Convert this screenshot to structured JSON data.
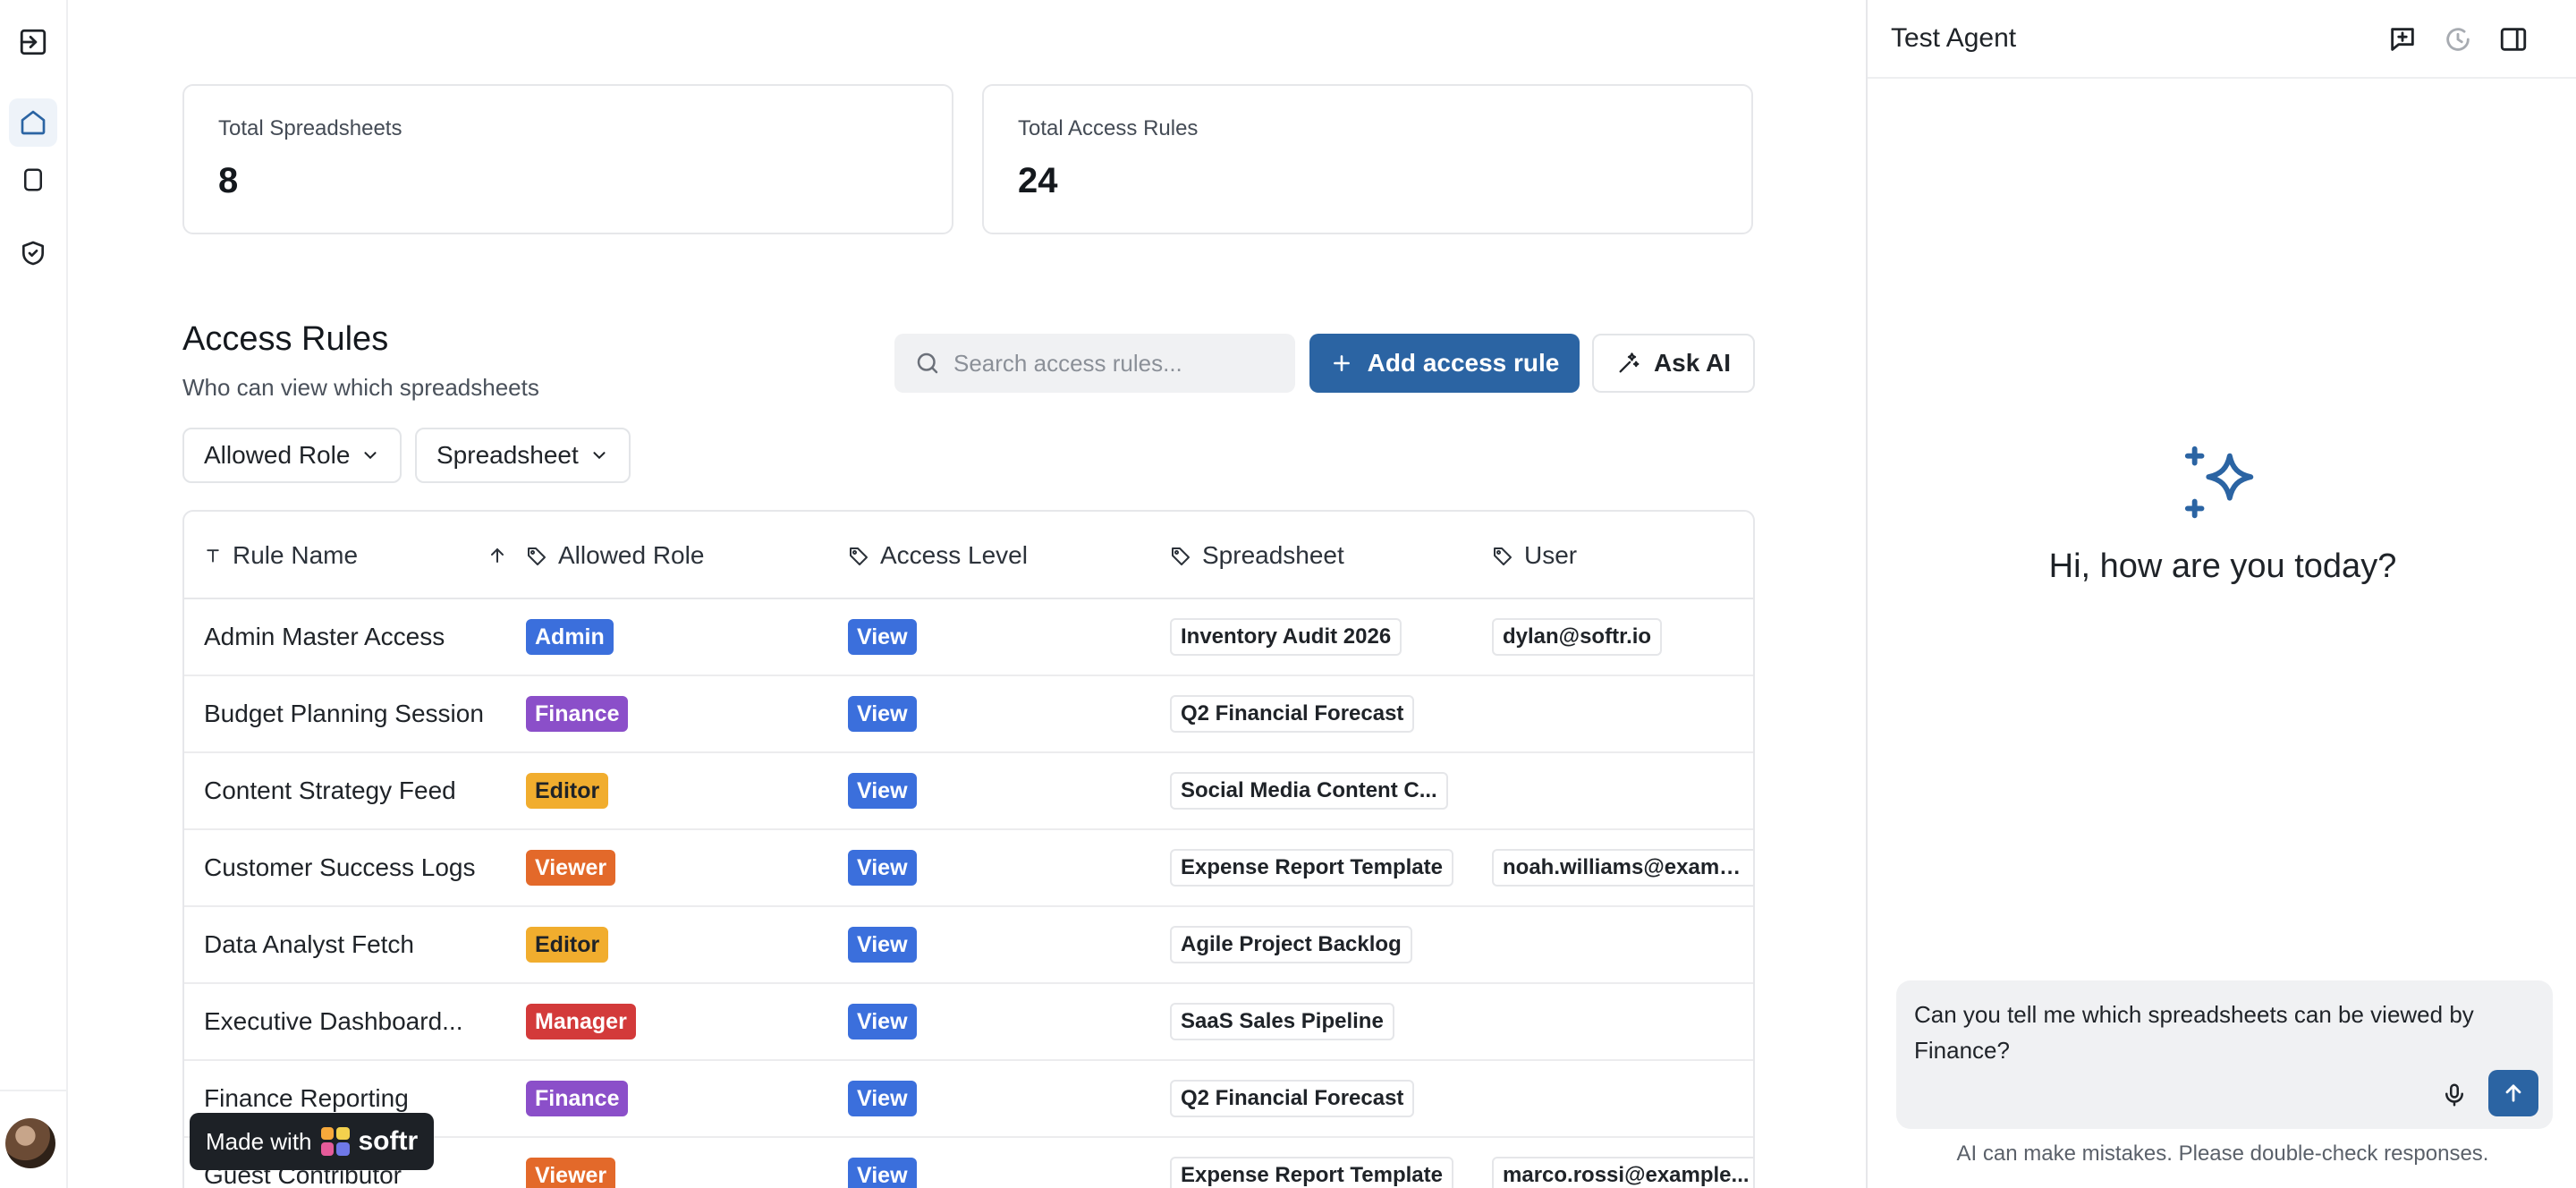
{
  "stats": [
    {
      "label": "Total Spreadsheets",
      "value": "8"
    },
    {
      "label": "Total Access Rules",
      "value": "24"
    }
  ],
  "section": {
    "title": "Access Rules",
    "subtitle": "Who can view which spreadsheets"
  },
  "search": {
    "placeholder": "Search access rules..."
  },
  "actions": {
    "add_label": "Add access rule",
    "ask_label": "Ask AI"
  },
  "filters": [
    "Allowed Role",
    "Spreadsheet"
  ],
  "table": {
    "headers": [
      "Rule Name",
      "Allowed Role",
      "Access Level",
      "Spreadsheet",
      "User"
    ],
    "rows": [
      {
        "name": "Admin Master Access",
        "role": "Admin",
        "level": "View",
        "sheet": "Inventory Audit 2026",
        "user": "dylan@softr.io"
      },
      {
        "name": "Budget Planning Session",
        "role": "Finance",
        "level": "View",
        "sheet": "Q2 Financial Forecast",
        "user": ""
      },
      {
        "name": "Content Strategy Feed",
        "role": "Editor",
        "level": "View",
        "sheet": "Social Media Content C...",
        "user": ""
      },
      {
        "name": "Customer Success Logs",
        "role": "Viewer",
        "level": "View",
        "sheet": "Expense Report Template",
        "user": "noah.williams@exampl..."
      },
      {
        "name": "Data Analyst Fetch",
        "role": "Editor",
        "level": "View",
        "sheet": "Agile Project Backlog",
        "user": ""
      },
      {
        "name": "Executive Dashboard...",
        "role": "Manager",
        "level": "View",
        "sheet": "SaaS Sales Pipeline",
        "user": ""
      },
      {
        "name": "Finance Reporting",
        "role": "Finance",
        "level": "View",
        "sheet": "Q2 Financial Forecast",
        "user": ""
      },
      {
        "name": "Guest Contributor",
        "role": "Viewer",
        "level": "View",
        "sheet": "Expense Report Template",
        "user": "marco.rossi@example..."
      }
    ]
  },
  "role_colors": {
    "Admin": "#3b6fdc",
    "Finance": "#8b4fc9",
    "Editor": "#f1ad2e",
    "Viewer": "#e3692a",
    "Manager": "#d33a3a"
  },
  "level_color": "#3b6fdc",
  "badge_text": {
    "made_with": "Made with",
    "brand": "softr"
  },
  "panel": {
    "title": "Test Agent",
    "greeting": "Hi, how are you today?",
    "composer_text": "Can you tell me which spreadsheets can be viewed by Finance?",
    "disclaimer": "AI can make mistakes. Please double-check responses."
  },
  "icons": {
    "rail": [
      "expand-icon",
      "home-icon",
      "page-icon",
      "shield-icon"
    ],
    "panel": [
      "new-chat-icon",
      "history-icon",
      "sidebar-toggle-icon"
    ]
  }
}
